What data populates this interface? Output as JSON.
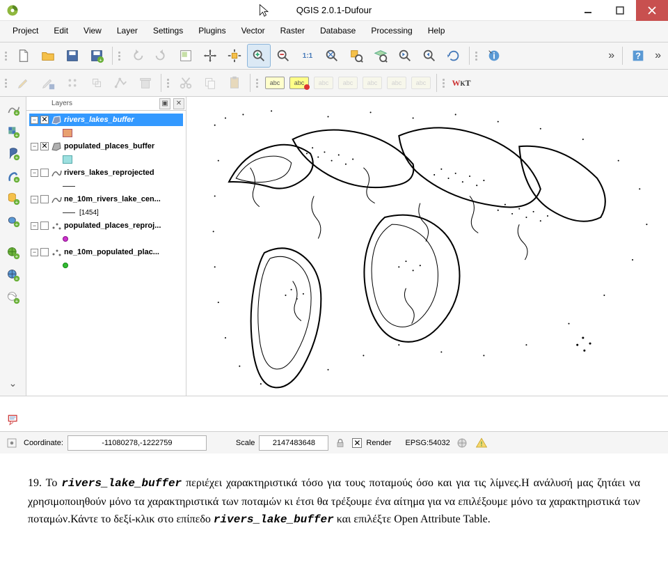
{
  "window": {
    "title": "QGIS 2.0.1-Dufour"
  },
  "menubar": {
    "items": [
      "Project",
      "Edit",
      "View",
      "Layer",
      "Settings",
      "Plugins",
      "Vector",
      "Raster",
      "Database",
      "Processing",
      "Help"
    ]
  },
  "layers_panel": {
    "title": "Layers",
    "items": [
      {
        "name": "rivers_lakes_buffer",
        "checked": true,
        "selected": true,
        "swatch": "polygon-orange"
      },
      {
        "name": "populated_places_buffer",
        "checked": true,
        "selected": false,
        "swatch": "polygon-cyan"
      },
      {
        "name": "rivers_lakes_reprojected",
        "checked": false,
        "selected": false,
        "swatch": "line"
      },
      {
        "name": "ne_10m_rivers_lake_cen...",
        "checked": false,
        "selected": false,
        "swatch": "line",
        "sublabel": "[1454]"
      },
      {
        "name": "populated_places_reproj...",
        "checked": false,
        "selected": false,
        "swatch": "point-magenta"
      },
      {
        "name": "ne_10m_populated_plac...",
        "checked": false,
        "selected": false,
        "swatch": "point-green"
      }
    ]
  },
  "statusbar": {
    "coordinate_label": "Coordinate:",
    "coordinate_value": "-11080278,-1222759",
    "scale_label": "Scale",
    "scale_value": "2147483648",
    "render_label": "Render",
    "crs_label": "EPSG:54032"
  },
  "instruction": {
    "number": "19.",
    "text_before_first_em": "Το ",
    "layer_name": "rivers_lake_buffer",
    "text_mid1": " περιέχει χαρακτηριστικά τόσο για τους ποταμούς όσο και για τις λίμνες.Η ανάλυσή μας ζητάει να χρησιμοποιηθούν μόνο τα χαρακτηριστικά των ποταμών κι έτσι θα τρέξουμε ένα αίτημα για να επιλέξουμε μόνο τα χαρακτηριστικά των ποταμών.Κάντε το δεξί-κλικ στο επίπεδο ",
    "layer_name_2": "rivers_lake_buffer",
    "text_mid2": " και επιλέξτε Open Attribute Table."
  }
}
